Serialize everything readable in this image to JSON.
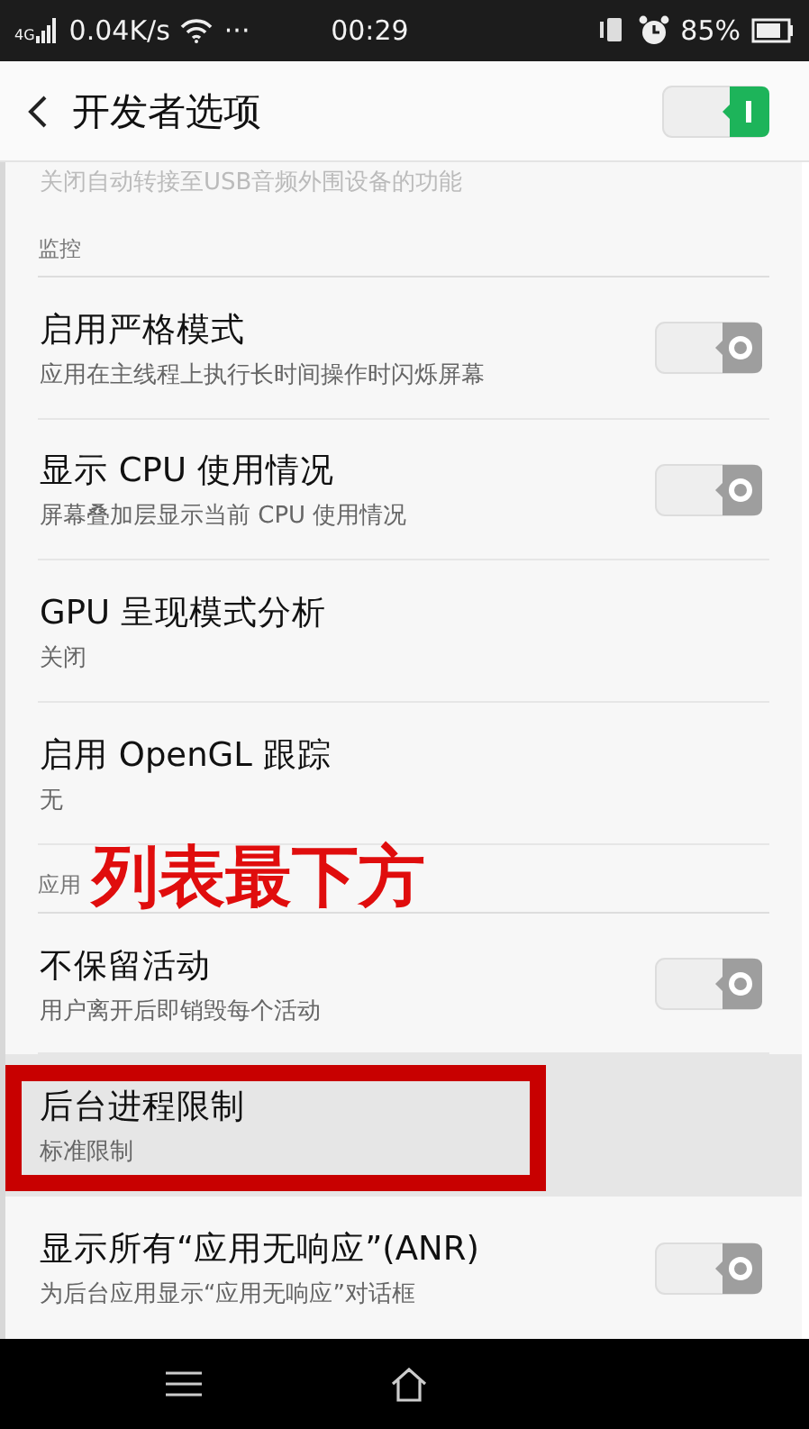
{
  "status_bar": {
    "network": "4G",
    "speed": "0.04K/s",
    "more": "···",
    "time": "00:29",
    "battery": "85%"
  },
  "header": {
    "title": "开发者选项",
    "master_on": true
  },
  "rows": [
    {
      "kind": "clipped",
      "summary": "关闭自动转接至USB音频外围设备的功能"
    },
    {
      "kind": "section",
      "label": "监控"
    },
    {
      "kind": "setting",
      "title": "启用严格模式",
      "summary": "应用在主线程上执行长时间操作时闪烁屏幕",
      "on": false,
      "selected": false
    },
    {
      "kind": "setting",
      "title": "显示 CPU 使用情况",
      "summary": "屏幕叠加层显示当前 CPU 使用情况",
      "on": false,
      "selected": false
    },
    {
      "kind": "setting",
      "title": "GPU 呈现模式分析",
      "summary": "关闭",
      "selected": false
    },
    {
      "kind": "setting",
      "title": "启用 OpenGL 跟踪",
      "summary": "无",
      "selected": false
    },
    {
      "kind": "section",
      "label": "应用",
      "annotation": "列表最下方"
    },
    {
      "kind": "setting",
      "title": "不保留活动",
      "summary": "用户离开后即销毁每个活动",
      "on": false,
      "selected": false
    },
    {
      "kind": "setting",
      "title": "后台进程限制",
      "summary": "标准限制",
      "selected": true,
      "boxed": true
    },
    {
      "kind": "setting",
      "title": "显示所有“应用无响应”(ANR)",
      "summary": "为后台应用显示“应用无响应”对话框",
      "on": false,
      "selected": false
    }
  ]
}
